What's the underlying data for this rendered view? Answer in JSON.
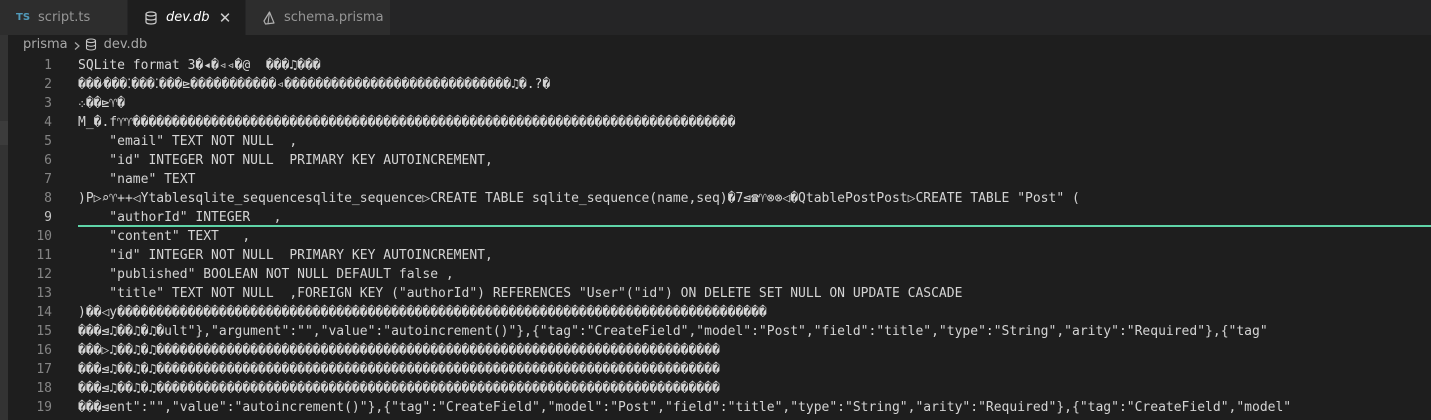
{
  "tabs": [
    {
      "icon": "typescript-icon",
      "icon_text": "TS",
      "label": "script.ts",
      "active": false
    },
    {
      "icon": "database-icon",
      "label": "dev.db",
      "active": true
    },
    {
      "icon": "prisma-icon",
      "label": "schema.prisma",
      "active": false
    }
  ],
  "breadcrumb": {
    "folder": "prisma",
    "file": "dev.db"
  },
  "colors": {
    "editor_bg": "#1e1e1e",
    "tab_bar_bg": "#252526",
    "line_number": "#858585",
    "text": "#d4d4d4",
    "cursor_line": "#5fd4a8",
    "ts_icon": "#519aba"
  },
  "editor": {
    "current_line": 9,
    "lines": [
      {
        "n": "1",
        "text": "SQLite format 3�◂�◃◃�@  ���♫���"
      },
      {
        "n": "2",
        "text": "���⁄���⁚���⁚���⊵�����������◃�����������������������������♫�.?�"
      },
      {
        "n": "3",
        "text": "܀��⊵♈�"
      },
      {
        "n": "4",
        "text": "M̲�.f♈♈�����������������������������������������������������������������������������"
      },
      {
        "n": "5",
        "text": "    \"email\" TEXT NOT NULL  ,"
      },
      {
        "n": "6",
        "text": "    \"id\" INTEGER NOT NULL  PRIMARY KEY AUTOINCREMENT,"
      },
      {
        "n": "7",
        "text": "    \"name\" TEXT"
      },
      {
        "n": "8",
        "text": ")P▷⌕♈++◁Ytablesqlite_sequencesqlite_sequence▷CREATE TABLE sqlite_sequence(name,seq)�7⊴☎♈⊗⊗◁�QtablePostPost▷CREATE TABLE \"Post\" ("
      },
      {
        "n": "9",
        "text": "    \"authorId\" INTEGER   ,"
      },
      {
        "n": "10",
        "text": "    \"content\" TEXT   ,"
      },
      {
        "n": "11",
        "text": "    \"id\" INTEGER NOT NULL  PRIMARY KEY AUTOINCREMENT,"
      },
      {
        "n": "12",
        "text": "    \"published\" BOOLEAN NOT NULL DEFAULT false ,"
      },
      {
        "n": "13",
        "text": "    \"title\" TEXT NOT NULL  ,FOREIGN KEY (\"authorId\") REFERENCES \"User\"(\"id\") ON DELETE SET NULL ON UPDATE CASCADE"
      },
      {
        "n": "14",
        "text": ")��◁y�����������������������������������������������������������������������������������"
      },
      {
        "n": "15",
        "text": "���⊴♫��♫�♫�ult\"},\"argument\":\"\",\"value\":\"autoincrement()\"},{\"tag\":\"CreateField\",\"model\":\"Post\",\"field\":\"title\",\"type\":\"String\",\"arity\":\"Required\"},{\"tag\""
      },
      {
        "n": "16",
        "text": "���▷♫��♫�♫������������������������������������������������������������������������"
      },
      {
        "n": "17",
        "text": "���⊴♫��♫�♫������������������������������������������������������������������������"
      },
      {
        "n": "18",
        "text": "���⊴♫��♫�♫������������������������������������������������������������������������"
      },
      {
        "n": "19",
        "text": "���⊴ent\":\"\",\"value\":\"autoincrement()\"},{\"tag\":\"CreateField\",\"model\":\"Post\",\"field\":\"title\",\"type\":\"String\",\"arity\":\"Required\"},{\"tag\":\"CreateField\",\"model\""
      }
    ]
  }
}
